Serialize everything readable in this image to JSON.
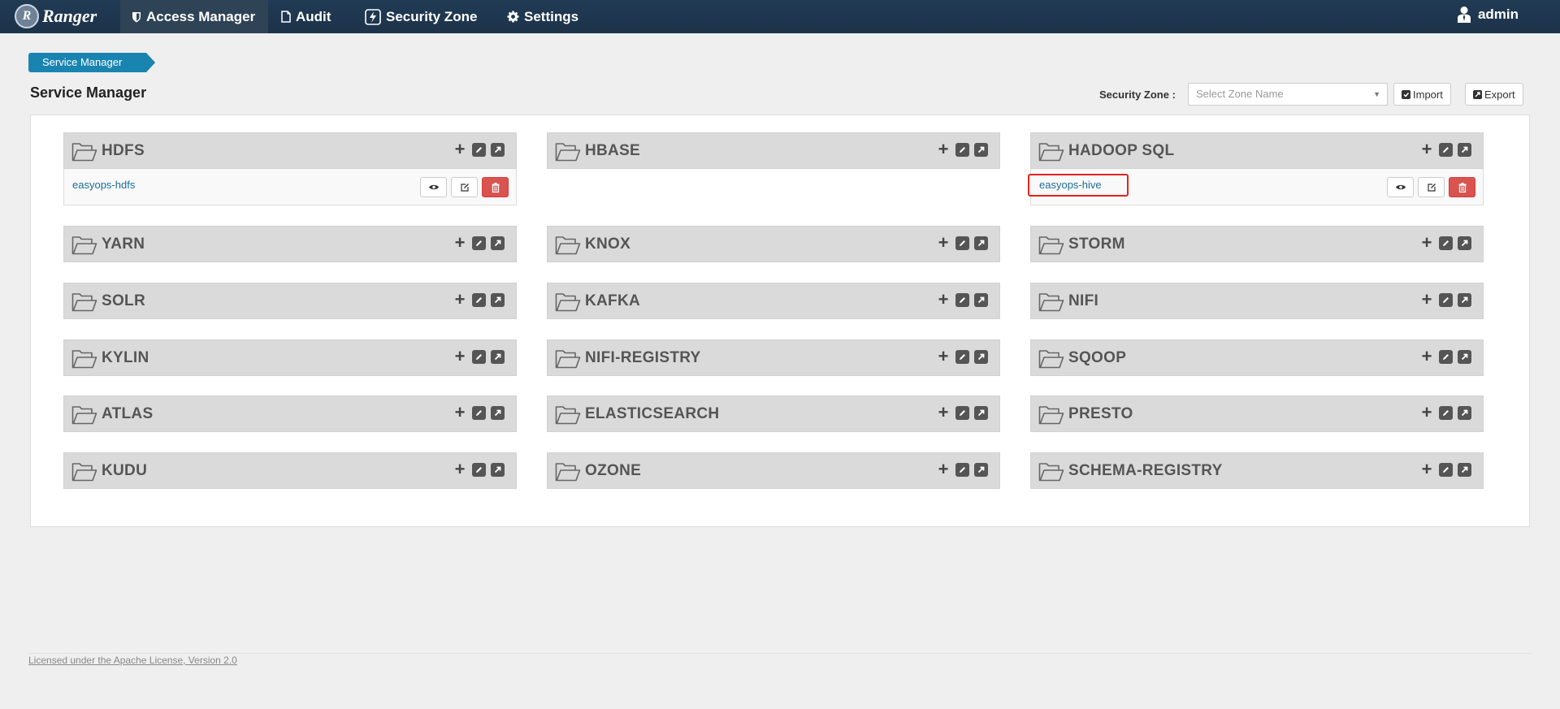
{
  "nav": {
    "brand": "Ranger",
    "brand_initial": "R",
    "items": [
      {
        "label": "Access Manager",
        "icon": "shield-icon"
      },
      {
        "label": "Audit",
        "icon": "file-icon"
      },
      {
        "label": "Security Zone",
        "icon": "bolt-icon"
      },
      {
        "label": "Settings",
        "icon": "gear-icon"
      }
    ],
    "user": "admin"
  },
  "breadcrumb": "Service Manager",
  "page_title": "Service Manager",
  "toolbar": {
    "zone_label": "Security Zone :",
    "zone_placeholder": "Select Zone Name",
    "import_label": "Import",
    "export_label": "Export"
  },
  "services": [
    {
      "name": "HDFS",
      "repo": "easyops-hdfs"
    },
    {
      "name": "HBASE"
    },
    {
      "name": "HADOOP SQL",
      "repo": "easyops-hive",
      "highlighted": true
    },
    {
      "name": "YARN"
    },
    {
      "name": "KNOX"
    },
    {
      "name": "STORM"
    },
    {
      "name": "SOLR"
    },
    {
      "name": "KAFKA"
    },
    {
      "name": "NIFI"
    },
    {
      "name": "KYLIN"
    },
    {
      "name": "NIFI-REGISTRY"
    },
    {
      "name": "SQOOP"
    },
    {
      "name": "ATLAS"
    },
    {
      "name": "ELASTICSEARCH"
    },
    {
      "name": "PRESTO"
    },
    {
      "name": "KUDU"
    },
    {
      "name": "OZONE"
    },
    {
      "name": "SCHEMA-REGISTRY"
    }
  ],
  "footer": "Licensed under the Apache License, Version 2.0",
  "colors": {
    "navbar": "#1c3349",
    "crumb": "#1a84b0",
    "link": "#1a6e99",
    "delete": "#d9534f",
    "highlight": "#e3231f"
  }
}
